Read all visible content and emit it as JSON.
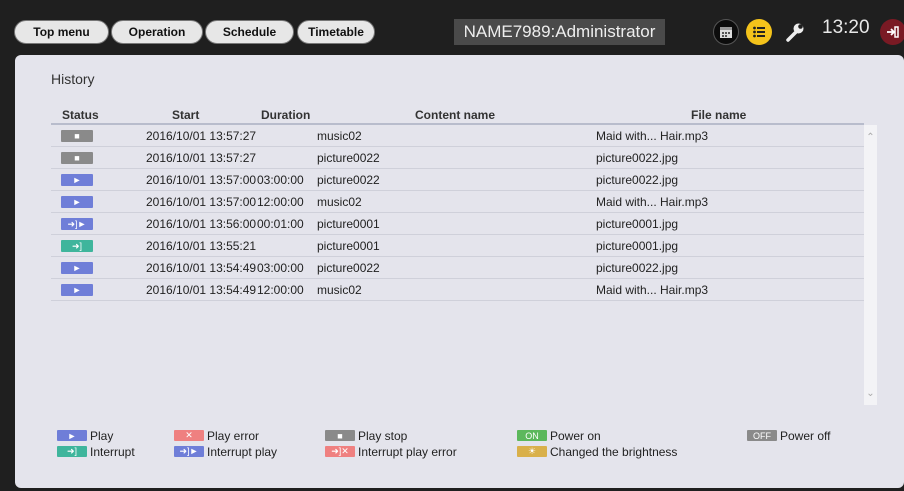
{
  "nav": {
    "top_menu": "Top menu",
    "operation": "Operation",
    "schedule": "Schedule",
    "timetable": "Timetable"
  },
  "user": "NAME7989:Administrator",
  "clock": "13:20",
  "panel": {
    "title": "History"
  },
  "columns": {
    "status": "Status",
    "start": "Start",
    "duration": "Duration",
    "content_name": "Content name",
    "file_name": "File name"
  },
  "rows": [
    {
      "status": "play-stop",
      "start": "2016/10/01 13:57:27",
      "duration": "",
      "content": "music02",
      "file": "Maid with... Hair.mp3"
    },
    {
      "status": "play-stop",
      "start": "2016/10/01 13:57:27",
      "duration": "",
      "content": "picture0022",
      "file": "picture0022.jpg"
    },
    {
      "status": "play",
      "start": "2016/10/01 13:57:00",
      "duration": "03:00:00",
      "content": "picture0022",
      "file": "picture0022.jpg"
    },
    {
      "status": "play",
      "start": "2016/10/01 13:57:00",
      "duration": "12:00:00",
      "content": "music02",
      "file": "Maid with... Hair.mp3"
    },
    {
      "status": "interrupt-play",
      "start": "2016/10/01 13:56:00",
      "duration": "00:01:00",
      "content": "picture0001",
      "file": "picture0001.jpg"
    },
    {
      "status": "interrupt",
      "start": "2016/10/01 13:55:21",
      "duration": "",
      "content": "picture0001",
      "file": "picture0001.jpg"
    },
    {
      "status": "play",
      "start": "2016/10/01 13:54:49",
      "duration": "03:00:00",
      "content": "picture0022",
      "file": "picture0022.jpg"
    },
    {
      "status": "play",
      "start": "2016/10/01 13:54:49",
      "duration": "12:00:00",
      "content": "music02",
      "file": "Maid with... Hair.mp3"
    }
  ],
  "legend": {
    "play": "Play",
    "play_error": "Play error",
    "play_stop": "Play stop",
    "power_on": "Power on",
    "power_on_badge": "ON",
    "power_off": "Power off",
    "power_off_badge": "OFF",
    "interrupt": "Interrupt",
    "interrupt_play": "Interrupt play",
    "interrupt_play_error": "Interrupt play error",
    "changed_brightness": "Changed the brightness"
  },
  "colors": {
    "play": "#6f7ed8",
    "play_stop": "#8a8a8a",
    "interrupt": "#3fb59c",
    "error": "#ef8080",
    "power_on": "#5cb85c",
    "power_off": "#8a8a8a",
    "brightness": "#d9b04a"
  },
  "icons": {
    "calendar": "calendar-icon",
    "list": "list-icon",
    "settings": "wrench-icon",
    "logout": "logout-icon"
  }
}
